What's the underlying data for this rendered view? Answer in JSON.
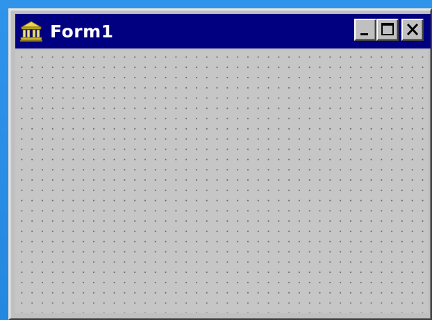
{
  "window": {
    "title": "Form1",
    "icon": "form-designer-icon",
    "controls": {
      "minimize_icon": "minimize-icon",
      "maximize_icon": "maximize-icon",
      "close_icon": "close-icon"
    }
  },
  "colors": {
    "desktop": "#2a8fe6",
    "titlebar": "#000080",
    "title_text": "#ffffff",
    "window_face": "#c0c0c0",
    "grid_dots": "#6c6c6c"
  }
}
